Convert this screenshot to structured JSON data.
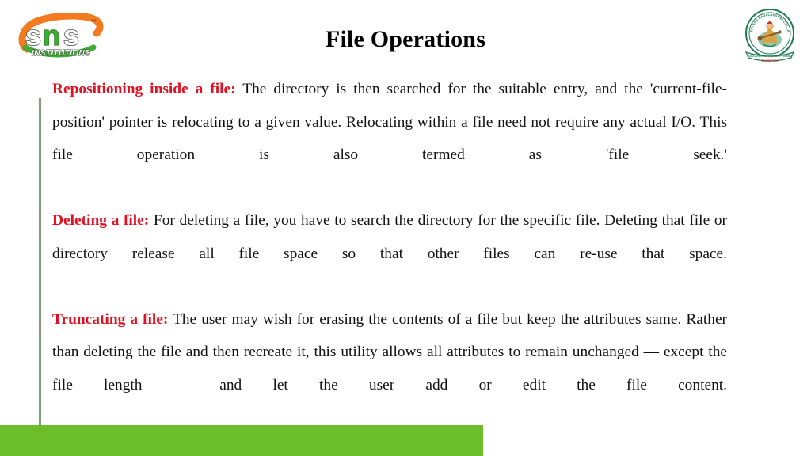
{
  "slide": {
    "title": "File Operations",
    "colors": {
      "heading_red": "#e01020",
      "body_black": "#111111",
      "accent_rule": "#7d9a79",
      "green_band": "#6cbe2b",
      "logo_orange": "#f47a20",
      "logo_green": "#3faa35",
      "crest_green": "#1c7a52"
    }
  },
  "logo": {
    "wordmark": "sns",
    "subtext": "INSTITUTIONS",
    "trademark": "™"
  },
  "crest": {
    "ring_text_top": "SRI SNS RAJALAKSHMI COLLEGE OF ARTS AND SCIENCE",
    "ribbon_text": "EDUCATION IS THE BEST FRIEND",
    "ribbon_sub": "COIMBATORE"
  },
  "content": {
    "paragraphs": [
      {
        "lead": "Repositioning inside a file:",
        "text": " The directory is then searched for the suitable entry, and the 'current-file-position' pointer is relocating to a given value. Relocating within a file need not require any actual I/O. This file operation is also termed as 'file seek.'"
      },
      {
        "lead": "Deleting a file:",
        "text": " For deleting a file, you have to search the directory for the specific file. Deleting that file or directory release all file space so that other files can re-use that space."
      },
      {
        "lead": "Truncating a file:",
        "text": " The user may wish for erasing the contents of a file but keep the attributes same. Rather than deleting the file and then recreate it, this utility allows all attributes to remain unchanged — except the file length — and let the user add or edit the file content."
      }
    ]
  }
}
